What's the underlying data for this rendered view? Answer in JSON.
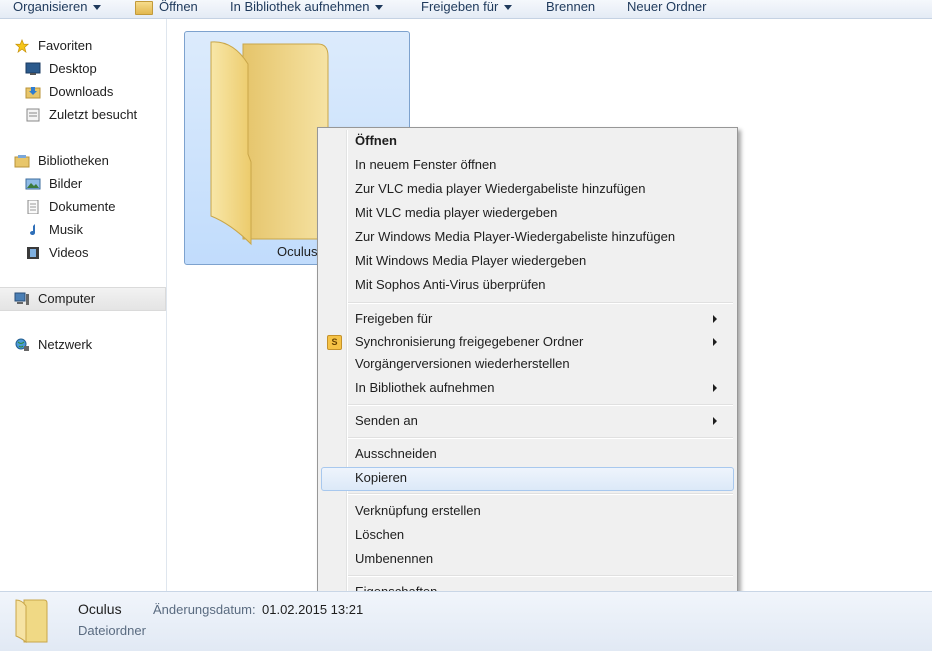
{
  "toolbar": {
    "organize": "Organisieren",
    "open": "Öffnen",
    "include_library": "In Bibliothek aufnehmen",
    "share_with": "Freigeben für",
    "burn": "Brennen",
    "new_folder": "Neuer Ordner"
  },
  "nav": {
    "favorites": "Favoriten",
    "desktop": "Desktop",
    "downloads": "Downloads",
    "recent": "Zuletzt besucht",
    "libraries": "Bibliotheken",
    "pictures": "Bilder",
    "documents": "Dokumente",
    "music": "Musik",
    "videos": "Videos",
    "computer": "Computer",
    "network": "Netzwerk"
  },
  "folder": {
    "name": "Oculus"
  },
  "menu": {
    "items": [
      "Öffnen",
      "In neuem Fenster öffnen",
      "Zur VLC media player Wiedergabeliste hinzufügen",
      "Mit VLC media player wiedergeben",
      "Zur Windows Media Player-Wiedergabeliste hinzufügen",
      "Mit Windows Media Player wiedergeben",
      "Mit Sophos Anti-Virus überprüfen",
      "Freigeben für",
      "Synchronisierung freigegebener Ordner",
      "Vorgängerversionen wiederherstellen",
      "In Bibliothek aufnehmen",
      "Senden an",
      "Ausschneiden",
      "Kopieren",
      "Verknüpfung erstellen",
      "Löschen",
      "Umbenennen",
      "Eigenschaften"
    ],
    "sync_icon_letter": "S"
  },
  "details": {
    "name": "Oculus",
    "type": "Dateiordner",
    "date_label": "Änderungsdatum:",
    "date_value": "01.02.2015 13:21"
  },
  "colors": {
    "selection": "#c1dcfc",
    "menu_bg": "#f0f0f0",
    "toolbar_text": "#1e395b"
  }
}
